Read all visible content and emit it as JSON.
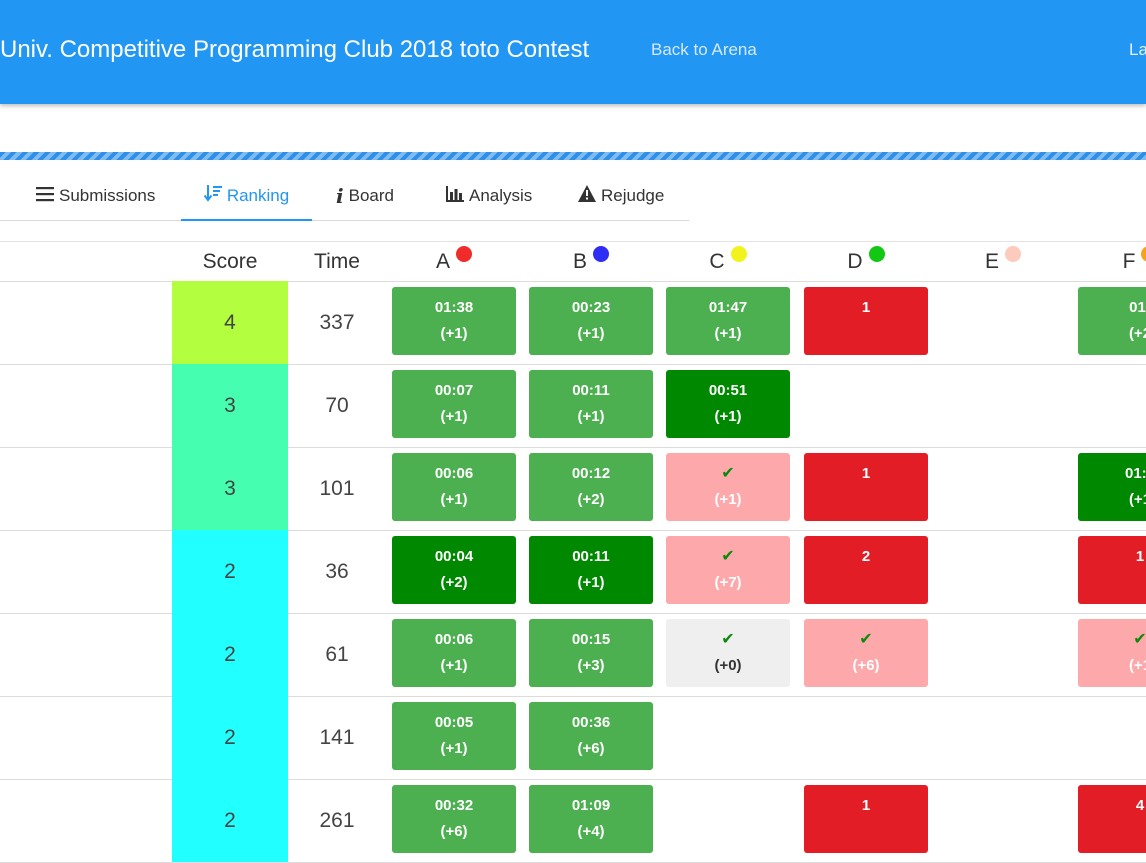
{
  "header": {
    "title": "Univ. Competitive Programming Club 2018 toto Contest",
    "back_link": "Back to Arena",
    "right_link": "La"
  },
  "tabs": [
    {
      "label": "Submissions",
      "icon": "list-icon"
    },
    {
      "label": "Ranking",
      "icon": "sort-icon"
    },
    {
      "label": "Board",
      "icon": "info-icon"
    },
    {
      "label": "Analysis",
      "icon": "bar-chart-icon"
    },
    {
      "label": "Rejudge",
      "icon": "warning-icon"
    }
  ],
  "columns": {
    "score": "Score",
    "time": "Time",
    "problems": [
      {
        "label": "A",
        "color": "#f02b2b"
      },
      {
        "label": "B",
        "color": "#2e2ef5"
      },
      {
        "label": "C",
        "color": "#f2f21c"
      },
      {
        "label": "D",
        "color": "#12c812"
      },
      {
        "label": "E",
        "color": "#fccbbd"
      },
      {
        "label": "F",
        "color": "#f5a31f"
      }
    ]
  },
  "colors": {
    "solved": "#4caf50",
    "first_solve": "#008800",
    "wrong": "#e31d25",
    "pending": "#fda9ab",
    "pending_gray": "#efefef",
    "score_4": "#b2fe3f",
    "score_3": "#45feb0",
    "score_2": "#21ffff"
  },
  "rows": [
    {
      "score": "4",
      "time": "337",
      "score_color": "#b2fe3f",
      "cells": [
        {
          "status": "solved",
          "line1": "01:38",
          "line2": "(+1)"
        },
        {
          "status": "solved",
          "line1": "00:23",
          "line2": "(+1)"
        },
        {
          "status": "solved",
          "line1": "01:47",
          "line2": "(+1)"
        },
        {
          "status": "wrong",
          "line1": "1",
          "line2": ""
        },
        {
          "status": "empty",
          "line1": "",
          "line2": ""
        },
        {
          "status": "solved",
          "line1": "01:",
          "line2": "(+2"
        }
      ]
    },
    {
      "score": "3",
      "time": "70",
      "score_color": "#45feb0",
      "cells": [
        {
          "status": "solved",
          "line1": "00:07",
          "line2": "(+1)"
        },
        {
          "status": "solved",
          "line1": "00:11",
          "line2": "(+1)"
        },
        {
          "status": "first",
          "line1": "00:51",
          "line2": "(+1)"
        },
        {
          "status": "empty",
          "line1": "",
          "line2": ""
        },
        {
          "status": "empty",
          "line1": "",
          "line2": ""
        },
        {
          "status": "empty",
          "line1": "",
          "line2": ""
        }
      ]
    },
    {
      "score": "3",
      "time": "101",
      "score_color": "#45feb0",
      "cells": [
        {
          "status": "solved",
          "line1": "00:06",
          "line2": "(+1)"
        },
        {
          "status": "solved",
          "line1": "00:12",
          "line2": "(+2)"
        },
        {
          "status": "pending",
          "line1": "✔",
          "line2": "(+1)"
        },
        {
          "status": "wrong",
          "line1": "1",
          "line2": ""
        },
        {
          "status": "empty",
          "line1": "",
          "line2": ""
        },
        {
          "status": "first",
          "line1": "01:0",
          "line2": "(+1"
        }
      ]
    },
    {
      "score": "2",
      "time": "36",
      "score_color": "#21ffff",
      "cells": [
        {
          "status": "first",
          "line1": "00:04",
          "line2": "(+2)"
        },
        {
          "status": "first",
          "line1": "00:11",
          "line2": "(+1)"
        },
        {
          "status": "pending",
          "line1": "✔",
          "line2": "(+7)"
        },
        {
          "status": "wrong",
          "line1": "2",
          "line2": ""
        },
        {
          "status": "empty",
          "line1": "",
          "line2": ""
        },
        {
          "status": "wrong",
          "line1": "1",
          "line2": ""
        }
      ]
    },
    {
      "score": "2",
      "time": "61",
      "score_color": "#21ffff",
      "cells": [
        {
          "status": "solved",
          "line1": "00:06",
          "line2": "(+1)"
        },
        {
          "status": "solved",
          "line1": "00:15",
          "line2": "(+3)"
        },
        {
          "status": "gray",
          "line1": "✔",
          "line2": "(+0)"
        },
        {
          "status": "pending",
          "line1": "✔",
          "line2": "(+6)"
        },
        {
          "status": "empty",
          "line1": "",
          "line2": ""
        },
        {
          "status": "pending",
          "line1": "✔",
          "line2": "(+1"
        }
      ]
    },
    {
      "score": "2",
      "time": "141",
      "score_color": "#21ffff",
      "cells": [
        {
          "status": "solved",
          "line1": "00:05",
          "line2": "(+1)"
        },
        {
          "status": "solved",
          "line1": "00:36",
          "line2": "(+6)"
        },
        {
          "status": "empty",
          "line1": "",
          "line2": ""
        },
        {
          "status": "empty",
          "line1": "",
          "line2": ""
        },
        {
          "status": "empty",
          "line1": "",
          "line2": ""
        },
        {
          "status": "empty",
          "line1": "",
          "line2": ""
        }
      ]
    },
    {
      "score": "2",
      "time": "261",
      "score_color": "#21ffff",
      "cells": [
        {
          "status": "solved",
          "line1": "00:32",
          "line2": "(+6)"
        },
        {
          "status": "solved",
          "line1": "01:09",
          "line2": "(+4)"
        },
        {
          "status": "empty",
          "line1": "",
          "line2": ""
        },
        {
          "status": "wrong",
          "line1": "1",
          "line2": ""
        },
        {
          "status": "empty",
          "line1": "",
          "line2": ""
        },
        {
          "status": "wrong",
          "line1": "4",
          "line2": ""
        }
      ]
    }
  ]
}
